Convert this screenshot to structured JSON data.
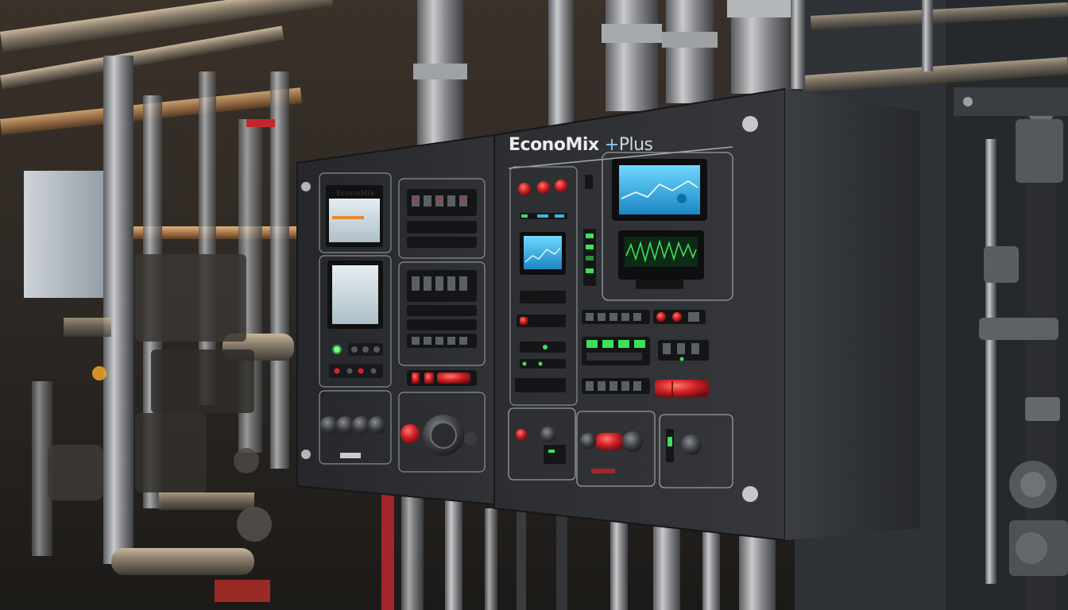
{
  "brand": {
    "name": "EconoMix",
    "mark": "+",
    "suffix": "Plus"
  },
  "left_panel": {
    "screen_label": "EconoMix"
  },
  "colors": {
    "panel": "#2b2d30",
    "panel_edge": "#1c1d1f",
    "pipe_steel": "#8d8f92",
    "pipe_copper": "#b8875a",
    "indicator_red": "#d3232a",
    "indicator_green": "#3ee05a",
    "screen_blue": "#35b6e8"
  },
  "icons": [
    "pipe",
    "control-panel",
    "touch-screen",
    "push-button",
    "rotary-knob",
    "indicator-light",
    "screw"
  ]
}
